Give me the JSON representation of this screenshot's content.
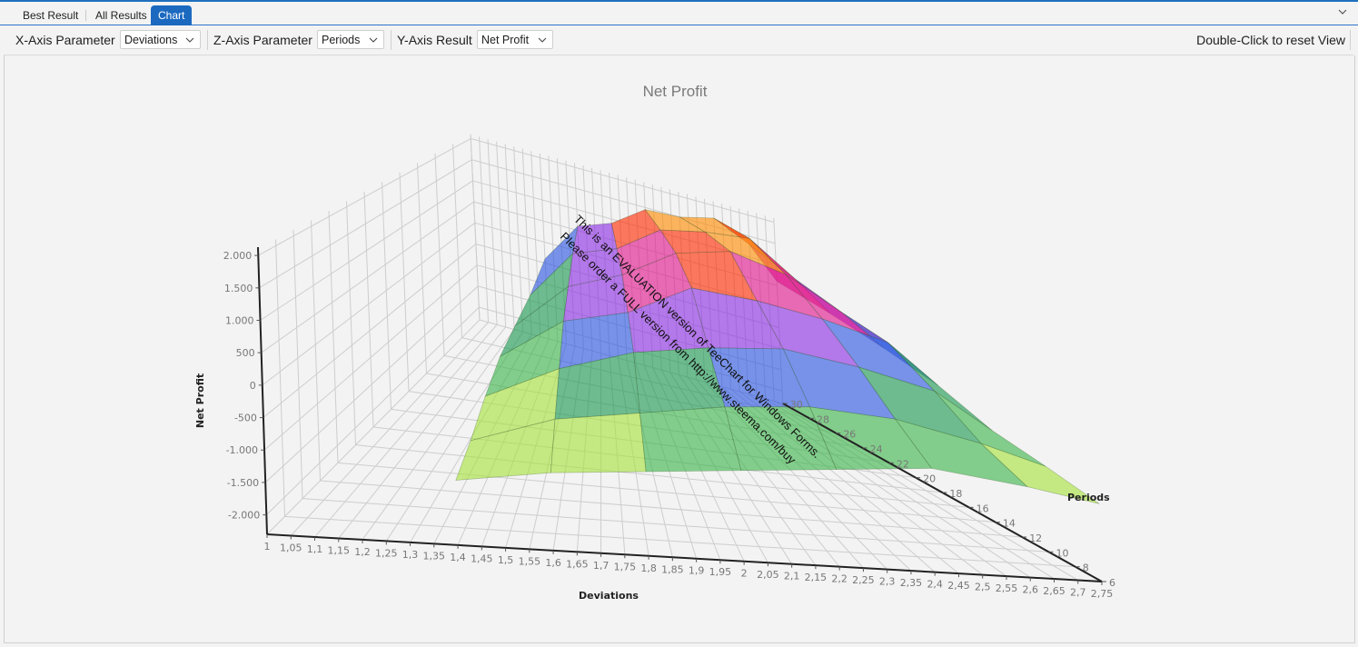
{
  "tabs": [
    {
      "label": "Best Result",
      "active": false
    },
    {
      "label": "All Results",
      "active": false
    },
    {
      "label": "Chart",
      "active": true
    }
  ],
  "tab_menu_icon": "chevron-down-icon",
  "toolbar": {
    "x_axis_label": "X-Axis Parameter",
    "x_axis_value": "Deviations",
    "z_axis_label": "Z-Axis Parameter",
    "z_axis_value": "Periods",
    "y_axis_label": "Y-Axis Result",
    "y_axis_value": "Net Profit",
    "reset_hint": "Double-Click to reset View"
  },
  "watermark": {
    "line1": "This is an EVALUATION version of TeeChart for Windows Forms.",
    "line2": "Please order a FULL version from http://www.steema.com/buy"
  },
  "chart_data": {
    "type": "surface3d",
    "title": "Net Profit",
    "xlabel": "Deviations",
    "ylabel": "Net Profit",
    "zlabel": "Periods",
    "x_ticks": [
      "1",
      "1,05",
      "1,1",
      "1,15",
      "1,2",
      "1,25",
      "1,3",
      "1,35",
      "1,4",
      "1,45",
      "1,5",
      "1,55",
      "1,6",
      "1,65",
      "1,7",
      "1,75",
      "1,8",
      "1,85",
      "1,9",
      "1,95",
      "2",
      "2,05",
      "2,1",
      "2,15",
      "2,2",
      "2,25",
      "2,3",
      "2,35",
      "2,4",
      "2,45",
      "2,5",
      "2,55",
      "2,6",
      "2,65",
      "2,7",
      "2,75"
    ],
    "y_ticks": [
      "2.000",
      "1.500",
      "1.000",
      "500",
      "0",
      "-500",
      "-1.000",
      "-1.500",
      "-2.000"
    ],
    "y_tick_values": [
      2000,
      1500,
      1000,
      500,
      0,
      -500,
      -1000,
      -1500,
      -2000
    ],
    "z_ticks": [
      "6",
      "8",
      "10",
      "12",
      "14",
      "16",
      "18",
      "20",
      "22",
      "24",
      "26",
      "28",
      "30"
    ],
    "xlim": [
      1,
      2.75
    ],
    "ylim": [
      -2300,
      2100
    ],
    "zlim": [
      6,
      30
    ],
    "grid": true,
    "colormap": [
      "#ffd200",
      "#ffff40",
      "#a6e23c",
      "#3cb44b",
      "#1a9850",
      "#2a55e0",
      "#8a2be2",
      "#e0148c",
      "#ff2a00",
      "#ff8c00"
    ],
    "colormap_range": [
      -1800,
      1800
    ],
    "surface_x": [
      1.4,
      1.6,
      1.8,
      2.0,
      2.2,
      2.4,
      2.6,
      2.75
    ],
    "surface_z": [
      6,
      10,
      14,
      18,
      22,
      26,
      30
    ],
    "surface_y": [
      [
        -1300,
        -1150,
        -900,
        -700,
        -650,
        -600,
        -400
      ],
      [
        -1100,
        -700,
        -300,
        100,
        300,
        500,
        600
      ],
      [
        -1000,
        -500,
        100,
        400,
        700,
        800,
        900
      ],
      [
        -900,
        -300,
        300,
        1000,
        1300,
        1400,
        1450
      ],
      [
        -800,
        -200,
        400,
        900,
        1500,
        1550,
        1500
      ],
      [
        -700,
        -300,
        200,
        700,
        1200,
        1600,
        1700
      ],
      [
        -900,
        -600,
        -100,
        400,
        600,
        900,
        1300
      ],
      [
        -1100,
        -900,
        -700,
        -300,
        0,
        300,
        600
      ]
    ]
  }
}
